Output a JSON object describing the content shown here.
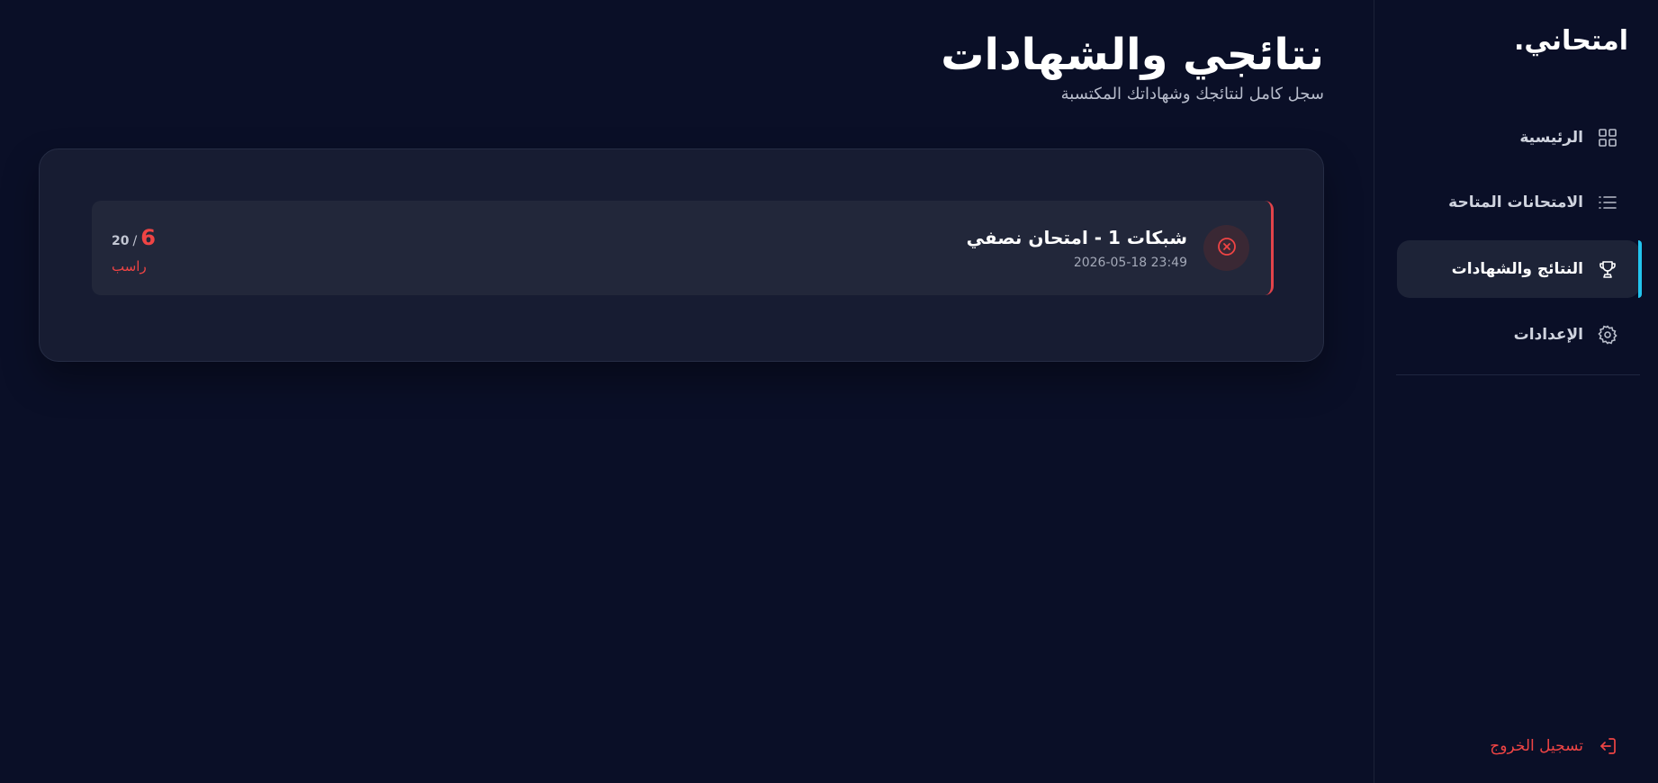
{
  "sidebar": {
    "brand": "امتحاني.",
    "items": [
      {
        "label": "الرئيسية",
        "icon": "grid-icon",
        "active": false
      },
      {
        "label": "الامتحانات المتاحة",
        "icon": "list-icon",
        "active": false
      },
      {
        "label": "النتائج والشهادات",
        "icon": "trophy-icon",
        "active": true
      },
      {
        "label": "الإعدادات",
        "icon": "gear-icon",
        "active": false
      }
    ],
    "logout_label": "تسجيل الخروج",
    "logout_icon": "logout-icon"
  },
  "header": {
    "title": "نتائجي والشهادات",
    "subtitle": "سجل كامل لنتائجك وشهاداتك المكتسبة"
  },
  "results": [
    {
      "title": "شبكات 1 - امتحان نصفي",
      "date": "2026-05-18 23:49",
      "score": "6",
      "separator": "/",
      "total": "20",
      "status": "راسب",
      "status_icon": "x-circle-icon"
    }
  ],
  "colors": {
    "background": "#0a0f27",
    "accent": "#22c4ee",
    "fail": "#ef4444"
  }
}
